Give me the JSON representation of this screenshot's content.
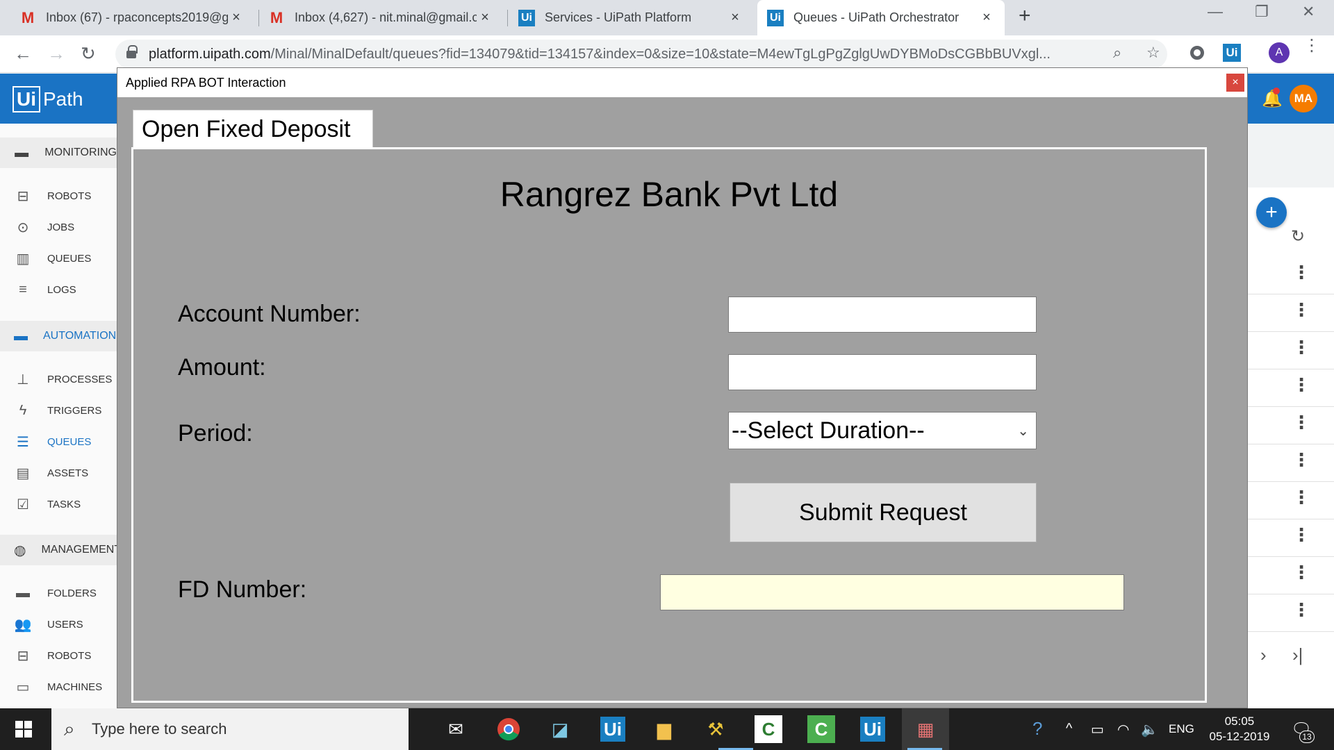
{
  "browser": {
    "tabs": [
      {
        "title": "Inbox (67) - rpaconcepts2019@g",
        "icon": "gmail-icon"
      },
      {
        "title": "Inbox (4,627) - nit.minal@gmail.c",
        "icon": "gmail-icon"
      },
      {
        "title": "Services - UiPath Platform",
        "icon": "uipath-icon"
      },
      {
        "title": "Queues - UiPath Orchestrator",
        "icon": "uipath-icon"
      }
    ],
    "url_host": "platform.uipath.com",
    "url_path": "/Minal/MinalDefault/queues?fid=134079&tid=134157&index=0&size=10&state=M4ewTgLgPgZglgUwDYBMoDsCGBbBUVxgl...",
    "profile_initial": "A",
    "extension_label": "Ui"
  },
  "orchestrator": {
    "logo_box": "Ui",
    "logo_text": "Path",
    "avatar_initials": "MA"
  },
  "sidebar": {
    "items": [
      {
        "label": "MONITORING",
        "icon": "folder-icon",
        "section": true
      },
      {
        "label": "ROBOTS",
        "icon": "robot-icon"
      },
      {
        "label": "JOBS",
        "icon": "play-circle-icon"
      },
      {
        "label": "QUEUES",
        "icon": "bar-chart-icon"
      },
      {
        "label": "LOGS",
        "icon": "list-icon"
      },
      {
        "label": "AUTOMATIONS",
        "icon": "folder-icon",
        "section": true,
        "active": true
      },
      {
        "label": "PROCESSES",
        "icon": "hierarchy-icon"
      },
      {
        "label": "TRIGGERS",
        "icon": "bolt-icon"
      },
      {
        "label": "QUEUES",
        "icon": "queue-icon",
        "active": true
      },
      {
        "label": "ASSETS",
        "icon": "asset-icon"
      },
      {
        "label": "TASKS",
        "icon": "clipboard-icon"
      },
      {
        "label": "MANAGEMENT",
        "icon": "globe-icon",
        "section": true
      },
      {
        "label": "FOLDERS",
        "icon": "folder-icon"
      },
      {
        "label": "USERS",
        "icon": "users-icon"
      },
      {
        "label": "ROBOTS",
        "icon": "robot-icon"
      },
      {
        "label": "MACHINES",
        "icon": "monitor-icon"
      }
    ]
  },
  "dialog": {
    "title": "Applied RPA BOT Interaction",
    "close_label": "×",
    "tab_label": "Open Fixed Deposit",
    "bank_name": "Rangrez Bank Pvt Ltd",
    "account_label": "Account Number:",
    "account_value": "",
    "amount_label": "Amount:",
    "amount_value": "",
    "period_label": "Period:",
    "period_selected": "--Select Duration--",
    "submit_label": "Submit Request",
    "fd_label": "FD Number:",
    "fd_value": ""
  },
  "taskbar": {
    "search_placeholder": "Type here to search",
    "language": "ENG",
    "time": "05:05",
    "date": "05-12-2019",
    "notification_count": "13"
  },
  "colors": {
    "orchestrator_blue": "#1a73c4",
    "dialog_gray": "#a0a0a0",
    "fd_output_bg": "#ffffe1",
    "close_red": "#d8473e"
  }
}
